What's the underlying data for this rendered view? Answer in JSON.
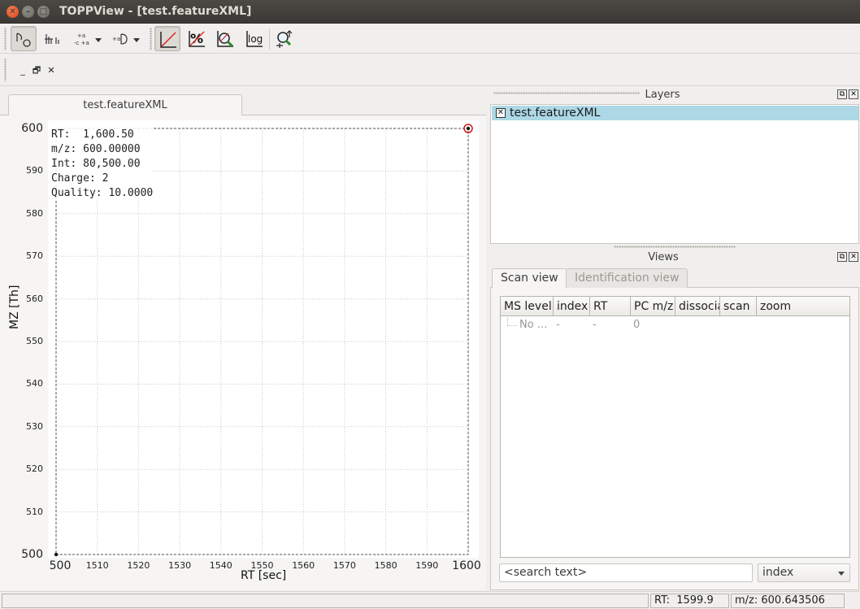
{
  "window": {
    "title": "TOPPView - [test.featureXML]"
  },
  "toolbar": {
    "buttons": [
      {
        "name": "zoom-mode",
        "pressed": true
      },
      {
        "name": "measure-mode"
      },
      {
        "name": "intensity-dropdown"
      },
      {
        "name": "peaks-dropdown"
      },
      {
        "name": "linear-intensity",
        "pressed": true
      },
      {
        "name": "percentage-intensity",
        "label": "%"
      },
      {
        "name": "snap-intensity"
      },
      {
        "name": "log-intensity",
        "label": "log"
      },
      {
        "name": "reset-zoom"
      }
    ]
  },
  "document": {
    "tab_label": "test.featureXML"
  },
  "plot": {
    "info": {
      "lines": [
        "RT:  1,600.50",
        "m/z: 600.00000",
        "Int: 80,500.00",
        "Charge: 2",
        "Quality: 10.0000"
      ]
    }
  },
  "chart_data": {
    "type": "scatter",
    "xlabel": "RT [sec]",
    "ylabel": "MZ [Th]",
    "xlim": [
      500,
      1600
    ],
    "ylim": [
      500,
      600
    ],
    "x_ticks": [
      "500",
      "1510",
      "1520",
      "1530",
      "1540",
      "1550",
      "1560",
      "1570",
      "1580",
      "1590",
      "1600"
    ],
    "y_ticks": [
      "600",
      "590",
      "580",
      "570",
      "560",
      "550",
      "540",
      "530",
      "520",
      "510",
      "500"
    ],
    "grid": true,
    "points": [
      {
        "x": 500,
        "y": 500,
        "selected": false
      },
      {
        "x": 1600.5,
        "y": 600,
        "selected": true
      }
    ]
  },
  "layers": {
    "title": "Layers",
    "items": [
      {
        "label": "test.featureXML",
        "checked": true
      }
    ]
  },
  "views": {
    "title": "Views",
    "tabs": [
      {
        "label": "Scan view",
        "active": true
      },
      {
        "label": "Identification view",
        "active": false
      }
    ],
    "table": {
      "columns": [
        "MS level",
        "index",
        "RT",
        "PC m/z",
        "dissociation",
        "scan",
        "zoom"
      ],
      "rows": [
        [
          "No ...",
          "-",
          "-",
          "0"
        ]
      ]
    },
    "search_placeholder": "<search text>",
    "search_field": "index"
  },
  "status": {
    "rt": "RT:  1599.9",
    "mz": "m/z: 600.643506"
  }
}
